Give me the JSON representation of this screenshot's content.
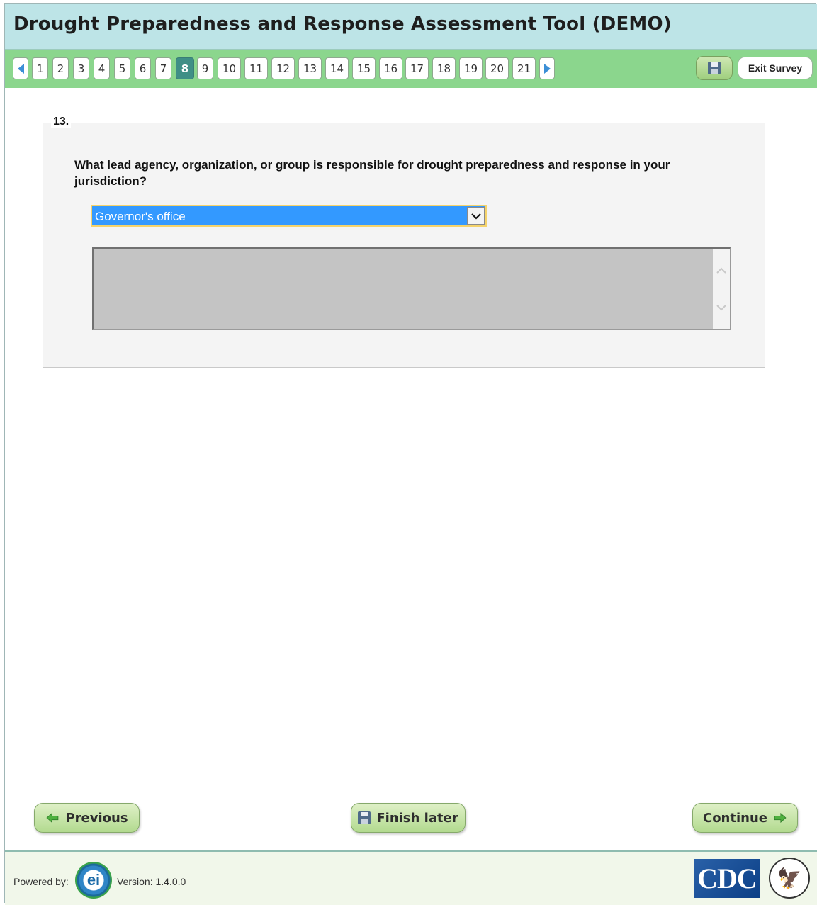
{
  "header": {
    "title": "Drought Preparedness and Response Assessment Tool (DEMO)"
  },
  "nav": {
    "pages": [
      "1",
      "2",
      "3",
      "4",
      "5",
      "6",
      "7",
      "8",
      "9",
      "10",
      "11",
      "12",
      "13",
      "14",
      "15",
      "16",
      "17",
      "18",
      "19",
      "20",
      "21"
    ],
    "active_page": "8",
    "prev_icon": "triangle-left-icon",
    "next_icon": "triangle-right-icon",
    "save_icon": "floppy-disk-icon",
    "exit_label": "Exit Survey"
  },
  "question": {
    "number": "13.",
    "text": "What lead agency, organization, or group is responsible for drought preparedness and response in your jurisdiction?",
    "selected_option": "Governor's office",
    "textarea_value": ""
  },
  "buttons": {
    "previous": "Previous",
    "finish_later": "Finish later",
    "continue": "Continue"
  },
  "footer": {
    "powered_by": "Powered by:",
    "logo_text": "ei",
    "version": "Version: 1.4.0.0",
    "cdc_logo": "CDC"
  },
  "colors": {
    "title_bar": "#bde4e7",
    "nav_bar": "#8bd68d",
    "active_page": "#3f8f86",
    "select_highlight": "#3399ff",
    "textarea_bg": "#c4c4c4"
  }
}
